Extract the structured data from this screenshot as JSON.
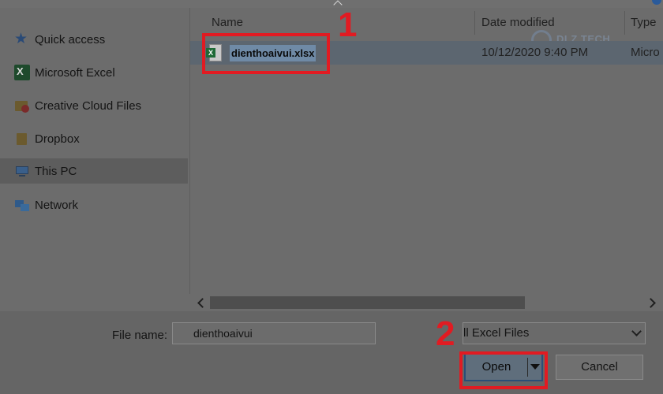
{
  "nav": {
    "items": [
      {
        "label": "Quick access",
        "icon": "star-icon"
      },
      {
        "label": "Microsoft Excel",
        "icon": "excel-icon"
      },
      {
        "label": "Creative Cloud Files",
        "icon": "creative-cloud-folder-icon"
      },
      {
        "label": "Dropbox",
        "icon": "folder-icon"
      },
      {
        "label": "This PC",
        "icon": "computer-icon",
        "selected": true
      },
      {
        "label": "Network",
        "icon": "network-icon"
      }
    ]
  },
  "files": {
    "columns": {
      "name": "Name",
      "date": "Date modified",
      "type": "Type"
    },
    "rows": [
      {
        "name": "dienthoaivui.xlsx",
        "date": "10/12/2020 9:40 PM",
        "type": "Micro",
        "selected": true
      }
    ]
  },
  "watermark": {
    "text": "DLZ TECH"
  },
  "annotations": {
    "step1": "1",
    "step2": "2",
    "highlight_color": "#e11b22"
  },
  "footer": {
    "file_name_label": "File name:",
    "file_name_value": "dienthoaivui",
    "file_type_filter": "ll Excel Files",
    "open_label": "Open",
    "cancel_label": "Cancel"
  }
}
